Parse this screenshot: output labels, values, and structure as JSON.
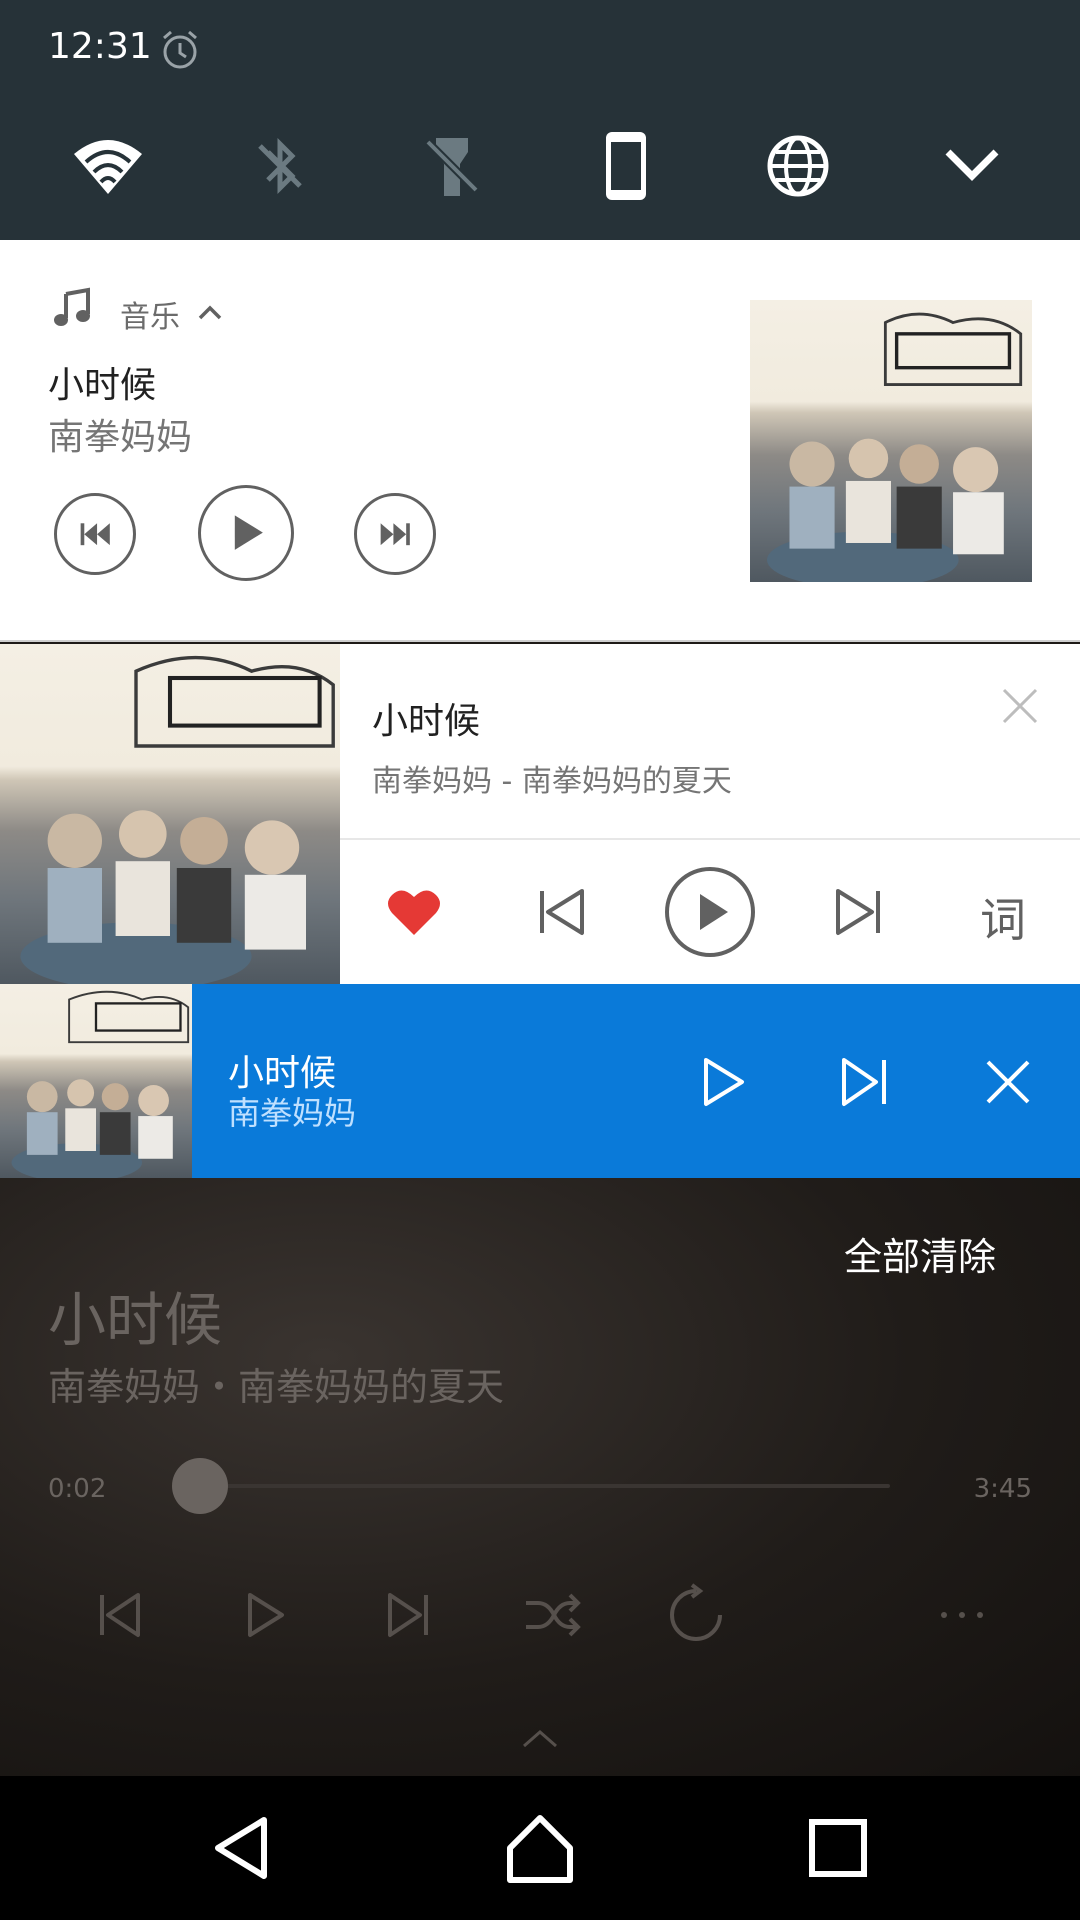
{
  "status": {
    "time": "12:31"
  },
  "quick_settings": {
    "tiles": [
      "wifi-icon",
      "bluetooth-off-icon",
      "flashlight-off-icon",
      "phone-portrait-icon",
      "globe-icon",
      "expand-icon"
    ]
  },
  "system_notification": {
    "app_name": "音乐",
    "title": "小时候",
    "artist": "南拳妈妈"
  },
  "app_notification": {
    "title": "小时候",
    "subtitle": "南拳妈妈 - 南拳妈妈的夏天",
    "lyrics_label": "词"
  },
  "compact_notification": {
    "title": "小时候",
    "artist": "南拳妈妈"
  },
  "player": {
    "clear_all": "全部清除",
    "title": "小时候",
    "subtitle": "南拳妈妈・南拳妈妈的夏天",
    "elapsed": "0:02",
    "duration": "3:45",
    "progress": 0.009
  },
  "colors": {
    "statusbar_bg": "#263238",
    "accent_blue": "#0a7ad9",
    "heart_red": "#e53935"
  }
}
